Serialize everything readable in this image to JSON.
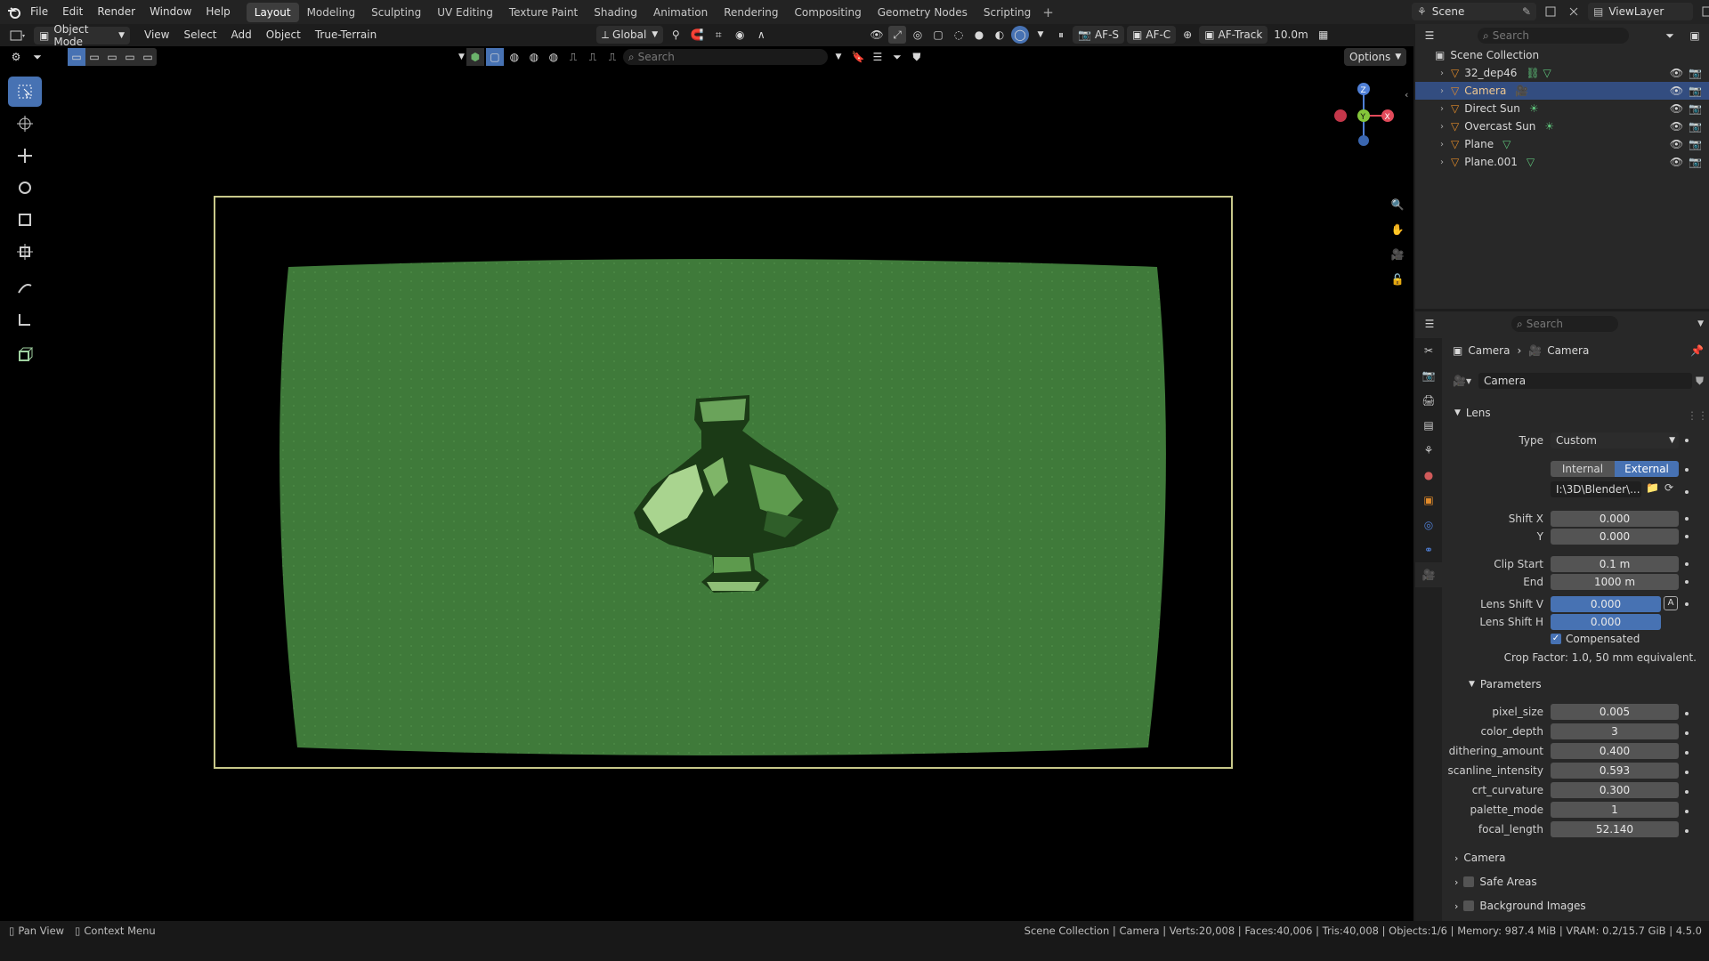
{
  "menu": {
    "items": [
      "File",
      "Edit",
      "Render",
      "Window",
      "Help"
    ]
  },
  "workspaces": [
    {
      "label": "Layout",
      "active": true
    },
    {
      "label": "Modeling"
    },
    {
      "label": "Sculpting"
    },
    {
      "label": "UV Editing"
    },
    {
      "label": "Texture Paint"
    },
    {
      "label": "Shading"
    },
    {
      "label": "Animation"
    },
    {
      "label": "Rendering"
    },
    {
      "label": "Compositing"
    },
    {
      "label": "Geometry Nodes"
    },
    {
      "label": "Scripting"
    }
  ],
  "top_right": {
    "scene": "Scene",
    "view_layer": "ViewLayer"
  },
  "viewport_header": {
    "mode": "Object Mode",
    "menus": [
      "View",
      "Select",
      "Add",
      "Object",
      "True-Terrain"
    ],
    "transform": "Global",
    "af_s": "AF-S",
    "af_c": "AF-C",
    "af_track": "AF-Track",
    "distance": "10.0m",
    "options": "Options",
    "search_placeholder": "Search"
  },
  "outliner": {
    "search_placeholder": "Search",
    "collection": "Scene Collection",
    "items": [
      {
        "label": "32_dep46",
        "selected": false
      },
      {
        "label": "Camera",
        "selected": true
      },
      {
        "label": "Direct Sun",
        "selected": false
      },
      {
        "label": "Overcast Sun",
        "selected": false
      },
      {
        "label": "Plane",
        "selected": false
      },
      {
        "label": "Plane.001",
        "selected": false
      }
    ]
  },
  "properties": {
    "search_placeholder": "Search",
    "breadcrumb": [
      "Camera",
      "Camera"
    ],
    "datablock": "Camera",
    "lens": {
      "title": "Lens",
      "type_label": "Type",
      "type_value": "Custom",
      "internal": "Internal",
      "external": "External",
      "path": "I:\\3D\\Blender\\...",
      "shift_x_label": "Shift X",
      "shift_x": "0.000",
      "shift_y_label": "Y",
      "shift_y": "0.000",
      "clip_start_label": "Clip Start",
      "clip_start": "0.1 m",
      "clip_end_label": "End",
      "clip_end": "1000 m",
      "lens_shift_v_label": "Lens Shift V",
      "lens_shift_v": "0.000",
      "lens_shift_h_label": "Lens Shift H",
      "lens_shift_h": "0.000",
      "compensated": "Compensated",
      "crop": "Crop Factor: 1.0, 50 mm equivalent."
    },
    "parameters": {
      "title": "Parameters",
      "rows": [
        {
          "label": "pixel_size",
          "value": "0.005"
        },
        {
          "label": "color_depth",
          "value": "3"
        },
        {
          "label": "dithering_amount",
          "value": "0.400"
        },
        {
          "label": "scanline_intensity",
          "value": "0.593"
        },
        {
          "label": "crt_curvature",
          "value": "0.300"
        },
        {
          "label": "palette_mode",
          "value": "1"
        },
        {
          "label": "focal_length",
          "value": "52.140"
        }
      ]
    },
    "sections": [
      "Camera",
      "Safe Areas",
      "Background Images"
    ]
  },
  "status": {
    "left1": "Pan View",
    "left2": "Context Menu",
    "right": "Scene Collection | Camera | Verts:20,008 | Faces:40,006 | Tris:40,008 | Objects:1/6 | Memory: 987.4 MiB | VRAM: 0.2/15.7 GiB | 4.5.0"
  },
  "colors": {
    "accent": "#4772b3",
    "screen_green": "#3f7a3a",
    "camera_frame": "#c8c88a"
  }
}
